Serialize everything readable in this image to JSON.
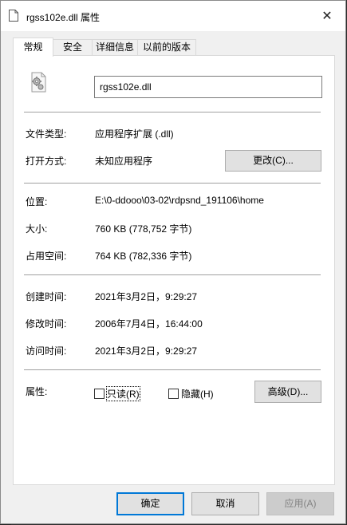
{
  "window": {
    "title": "rgss102e.dll 属性",
    "close_glyph": "✕"
  },
  "tabs": [
    {
      "label": "常规"
    },
    {
      "label": "安全"
    },
    {
      "label": "详细信息"
    },
    {
      "label": "以前的版本"
    }
  ],
  "general": {
    "file_name": "rgss102e.dll",
    "file_type_label": "文件类型:",
    "file_type_value": "应用程序扩展 (.dll)",
    "opens_with_label": "打开方式:",
    "opens_with_value": "未知应用程序",
    "change_button": "更改(C)...",
    "location_label": "位置:",
    "location_value": "E:\\0-ddooo\\03-02\\rdpsnd_191106\\home",
    "size_label": "大小:",
    "size_value": "760 KB (778,752 字节)",
    "size_on_disk_label": "占用空间:",
    "size_on_disk_value": "764 KB (782,336 字节)",
    "created_label": "创建时间:",
    "created_value": "2021年3月2日，9:29:27",
    "modified_label": "修改时间:",
    "modified_value": "2006年7月4日，16:44:00",
    "accessed_label": "访问时间:",
    "accessed_value": "2021年3月2日，9:29:27",
    "attributes_label": "属性:",
    "readonly_label": "只读(R)",
    "readonly_checked": false,
    "hidden_label": "隐藏(H)",
    "hidden_checked": false,
    "advanced_button": "高级(D)..."
  },
  "footer": {
    "ok": "确定",
    "cancel": "取消",
    "apply": "应用(A)"
  },
  "icons": {
    "title_file": "document-icon",
    "file_type": "dll-gear-icon"
  },
  "colors": {
    "accent": "#0078d7",
    "panel": "#ffffff",
    "window": "#f0f0f0"
  }
}
